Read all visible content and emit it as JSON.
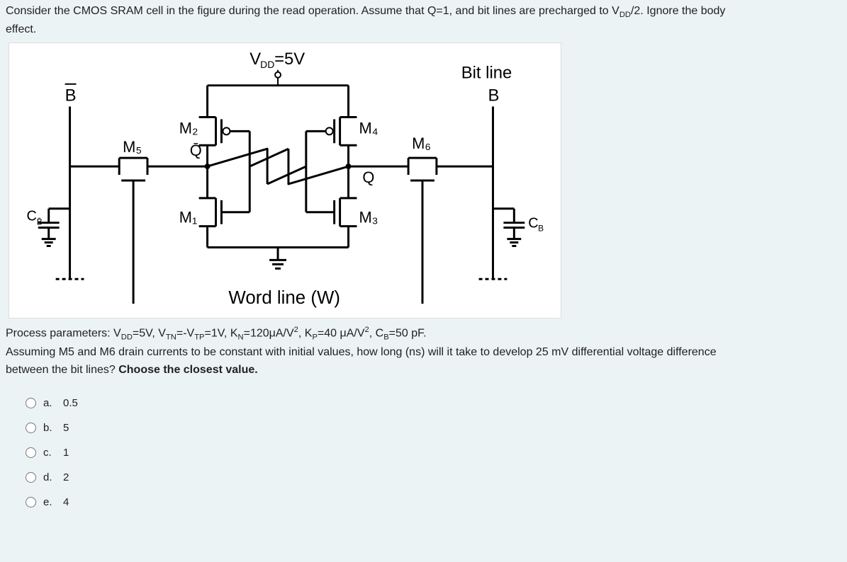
{
  "question": {
    "line1_a": "Consider the CMOS SRAM cell in the figure during the read operation. Assume that Q=1, and bit lines are precharged to V",
    "line1_sub": "DD",
    "line1_b": "/2. Ignore the body",
    "line2": "effect."
  },
  "figure": {
    "vdd_label": "V",
    "vdd_sub": "DD",
    "vdd_eq": "=5V",
    "bitline": "Bit line",
    "B": "B",
    "Bbar": "B̄",
    "M1": "M₁",
    "M2": "M₂",
    "M3": "M₃",
    "M4": "M₄",
    "M5": "M₅",
    "M6": "M₆",
    "Q": "Q",
    "Qbar": "Q̄",
    "CB": "Cᴮ",
    "CBbar": "C",
    "CBbar_sub": "B̄",
    "wordline": "Word line (W)"
  },
  "params": {
    "p1_a": "Process parameters: V",
    "p1_sub1": "DD",
    "p1_b": "=5V, V",
    "p1_sub2": "TN",
    "p1_c": "=-V",
    "p1_sub3": "TP",
    "p1_d": "=1V, K",
    "p1_sub4": "N",
    "p1_e": "=120μA/V",
    "p1_sup1": "2",
    "p1_f": ", K",
    "p1_sub5": "P",
    "p1_g": "=40 μA/V",
    "p1_sup2": "2",
    "p1_h": ", C",
    "p1_sub6": "B",
    "p1_i": "=50 pF.",
    "p2": "Assuming M5 and M6 drain currents to be constant with initial values, how long (ns) will it take to develop 25 mV differential voltage difference",
    "p3_a": "between the bit lines? ",
    "p3_b": "Choose the closest value."
  },
  "options": [
    {
      "letter": "a.",
      "text": "0.5"
    },
    {
      "letter": "b.",
      "text": "5"
    },
    {
      "letter": "c.",
      "text": "1"
    },
    {
      "letter": "d.",
      "text": "2"
    },
    {
      "letter": "e.",
      "text": "4"
    }
  ]
}
